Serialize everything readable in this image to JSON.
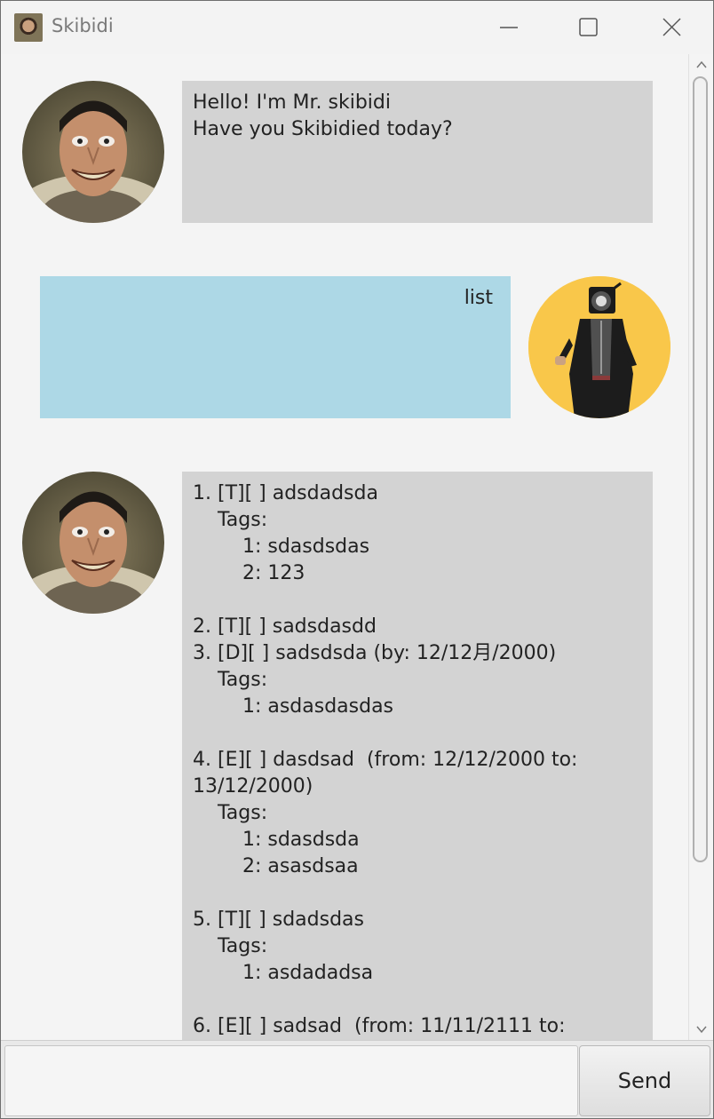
{
  "window": {
    "title": "Skibidi",
    "icon": "skibidi-toilet-icon"
  },
  "messages": [
    {
      "sender": "bot",
      "avatar": "skibidi-toilet-avatar",
      "text": "Hello! I'm Mr. skibidi\nHave you Skibidied today?"
    },
    {
      "sender": "user",
      "avatar": "cameraman-avatar",
      "text": "list"
    },
    {
      "sender": "bot",
      "avatar": "skibidi-toilet-avatar",
      "text": "1. [T][ ] adsdadsda\n    Tags:\n        1: sdasdsdas\n        2: 123\n\n2. [T][ ] sadsdasdd\n3. [D][ ] sadsdsda (by: 12/12月/2000)\n    Tags:\n        1: asdasdasdas\n\n4. [E][ ] dasdsad  (from: 12/12/2000 to: \n13/12/2000)\n    Tags:\n        1: sdasdsda\n        2: asasdsaa\n\n5. [T][ ] sdadsdas\n    Tags:\n        1: asdadadsa\n\n6. [E][ ] sadsad  (from: 11/11/2111 to:"
    }
  ],
  "input": {
    "value": "",
    "placeholder": ""
  },
  "send_button": {
    "label": "Send"
  },
  "colors": {
    "bot_bubble": "#d3d3d3",
    "user_bubble": "#add8e6",
    "user_avatar_bg": "#f9c74a"
  }
}
